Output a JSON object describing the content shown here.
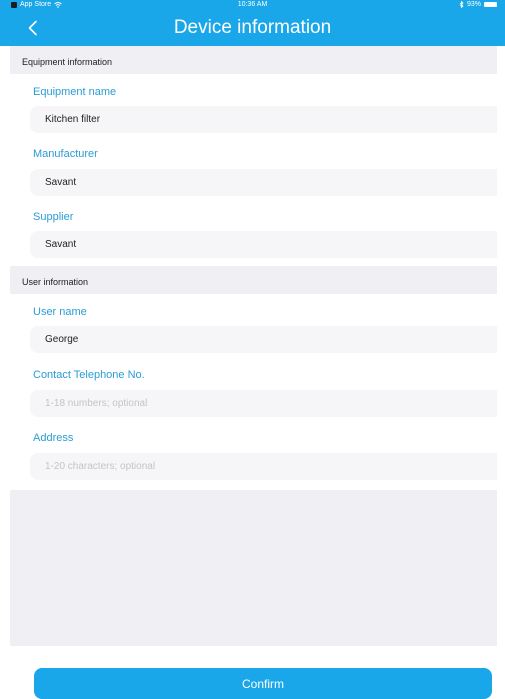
{
  "status_bar": {
    "carrier": "App Store",
    "wifi_icon": "wifi-icon",
    "time": "10:36 AM",
    "bluetooth_icon": "bluetooth-icon",
    "battery_percent": "93%",
    "battery_icon": "battery-icon"
  },
  "nav": {
    "back_icon": "chevron-left-icon",
    "title": "Device information"
  },
  "sections": {
    "equipment": {
      "header": "Equipment information",
      "name_label": "Equipment name",
      "name_value": "Kitchen filter",
      "manufacturer_label": "Manufacturer",
      "manufacturer_value": "Savant",
      "supplier_label": "Supplier",
      "supplier_value": "Savant"
    },
    "user": {
      "header": "User information",
      "username_label": "User name",
      "username_value": "George",
      "phone_label": "Contact Telephone No.",
      "phone_placeholder": "1-18 numbers; optional",
      "address_label": "Address",
      "address_placeholder": "1-20 characters; optional"
    }
  },
  "confirm_label": "Confirm",
  "colors": {
    "accent": "#1aa7ea",
    "label": "#2a9dd3",
    "background": "#efeff4"
  }
}
